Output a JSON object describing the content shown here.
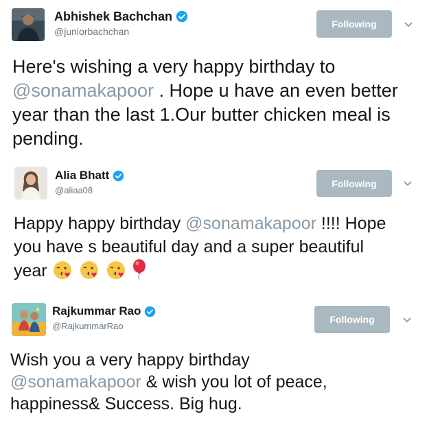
{
  "tweets": [
    {
      "display_name": "Abhishek Bachchan",
      "handle": "@juniorbachchan",
      "follow_label": "Following",
      "text_before": "Here's wishing a very happy birthday to",
      "mention": "@sonamakapoor",
      "text_after": ". Hope u have an even better year than the last 1.Our butter chicken meal is pending.",
      "avatar_icon": "person-photo-avatar"
    },
    {
      "display_name": "Alia Bhatt",
      "handle": "@aliaa08",
      "follow_label": "Following",
      "text_before": "Happy happy birthday",
      "mention": "@sonamakapoor",
      "text_after": "!!!! Hope you have s beautiful day and a super beautiful year",
      "emojis": [
        "kissing-face-icon",
        "kissing-face-icon",
        "kissing-face-icon",
        "balloon-icon"
      ],
      "avatar_icon": "person-photo-avatar"
    },
    {
      "display_name": "Rajkummar Rao",
      "handle": "@RajkummarRao",
      "follow_label": "Following",
      "text_before": "Wish you a very happy birthday",
      "mention": "@sonamakapoor",
      "text_after": "& wish you lot of peace, happiness& Success. Big hug.",
      "avatar_icon": "person-photo-avatar"
    }
  ],
  "colors": {
    "verified": "#1da1f2",
    "follow_button": "#aab8c2",
    "mention": "#8899a6",
    "handle": "#657786"
  }
}
